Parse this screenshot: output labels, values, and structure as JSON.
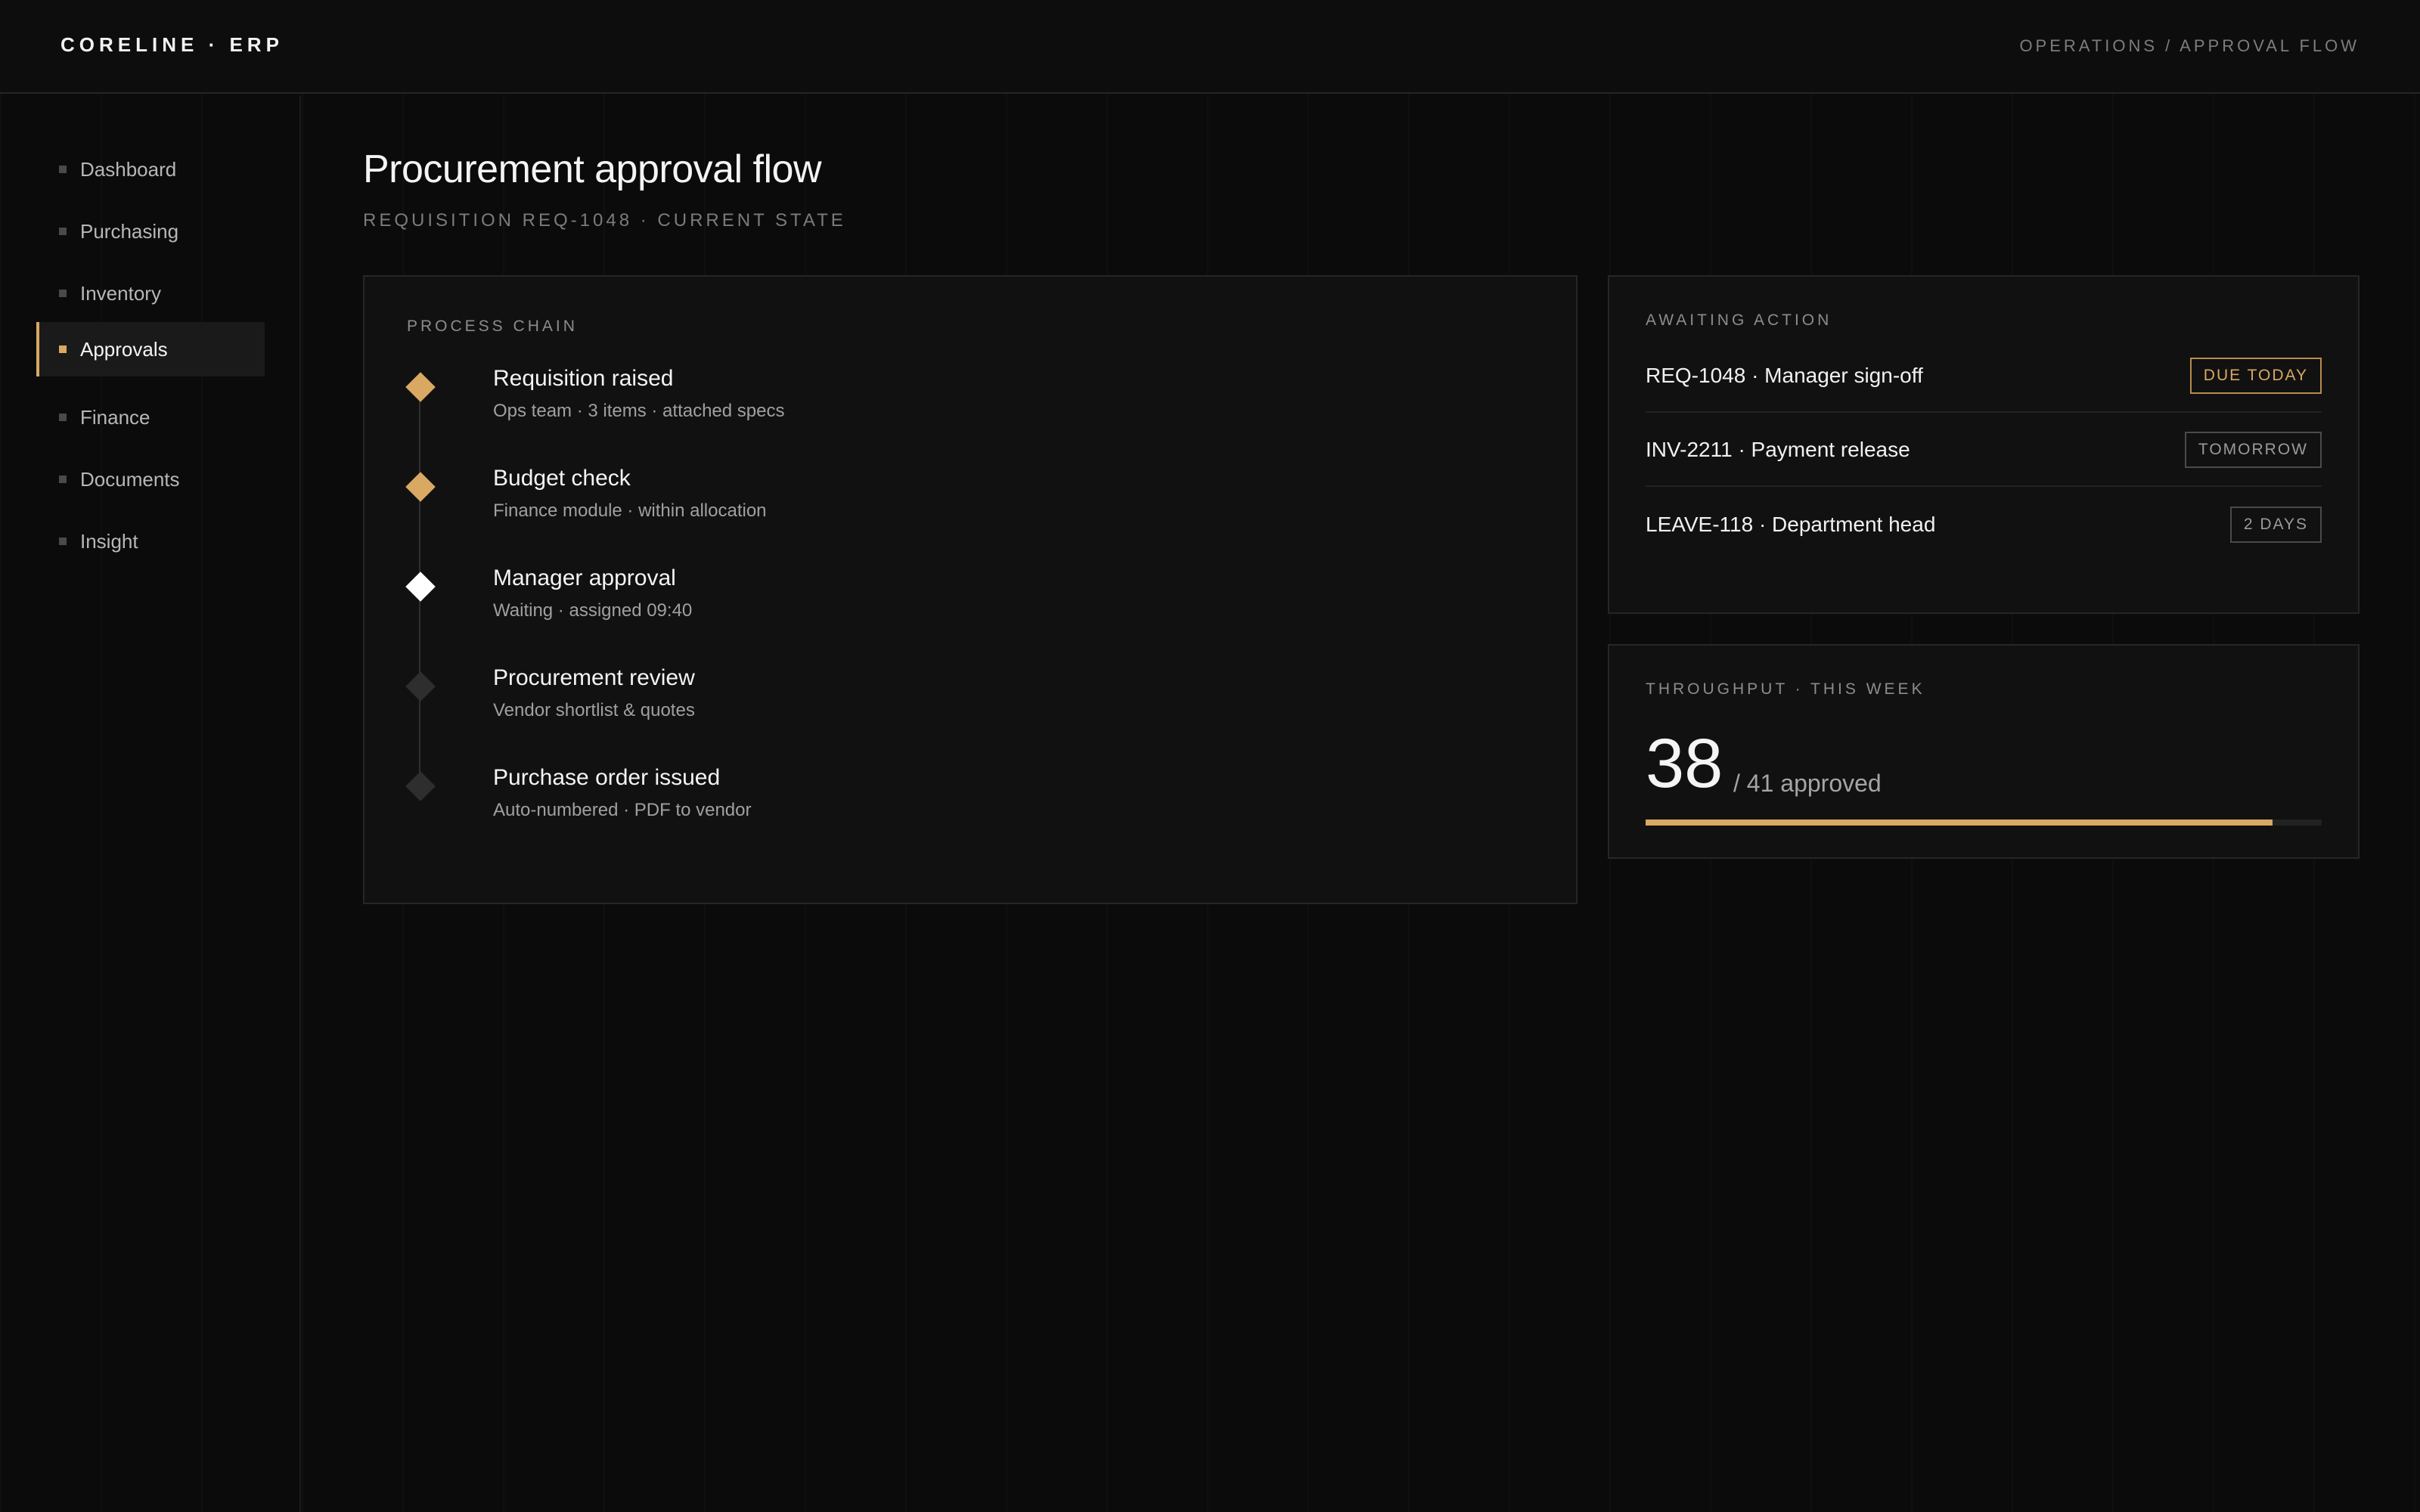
{
  "app": {
    "brand": "CORELINE · ERP",
    "breadcrumb": "OPERATIONS / APPROVAL FLOW"
  },
  "sidebar": {
    "items": [
      {
        "label": "Dashboard",
        "active": false
      },
      {
        "label": "Purchasing",
        "active": false
      },
      {
        "label": "Inventory",
        "active": false
      },
      {
        "label": "Approvals",
        "active": true
      },
      {
        "label": "Finance",
        "active": false
      },
      {
        "label": "Documents",
        "active": false
      },
      {
        "label": "Insight",
        "active": false
      }
    ]
  },
  "page": {
    "title": "Procurement approval flow",
    "subtitle": "REQUISITION REQ-1048 · CURRENT STATE"
  },
  "process_chain": {
    "label": "PROCESS CHAIN",
    "steps": [
      {
        "title": "Requisition raised",
        "detail": "Ops team · 3 items · attached specs",
        "state": "done"
      },
      {
        "title": "Budget check",
        "detail": "Finance module · within allocation",
        "state": "done"
      },
      {
        "title": "Manager approval",
        "detail": "Waiting · assigned 09:40",
        "state": "current"
      },
      {
        "title": "Procurement review",
        "detail": "Vendor shortlist & quotes",
        "state": "pending"
      },
      {
        "title": "Purchase order issued",
        "detail": "Auto-numbered · PDF to vendor",
        "state": "pending"
      }
    ]
  },
  "awaiting": {
    "label": "AWAITING ACTION",
    "items": [
      {
        "text": "REQ-1048 · Manager sign-off",
        "badge": "DUE TODAY"
      },
      {
        "text": "INV-2211 · Payment release",
        "badge": "TOMORROW"
      },
      {
        "text": "LEAVE-118 · Department head",
        "badge": "2 DAYS"
      }
    ]
  },
  "throughput": {
    "label": "THROUGHPUT · THIS WEEK",
    "approved": "38",
    "rest": "/ 41 approved",
    "progress_fraction": 0.927
  },
  "colors": {
    "accent": "#d9a862",
    "current": "#ffffff",
    "pending": "#2e2e2e",
    "background": "#0b0b0b",
    "card": "#111111"
  }
}
